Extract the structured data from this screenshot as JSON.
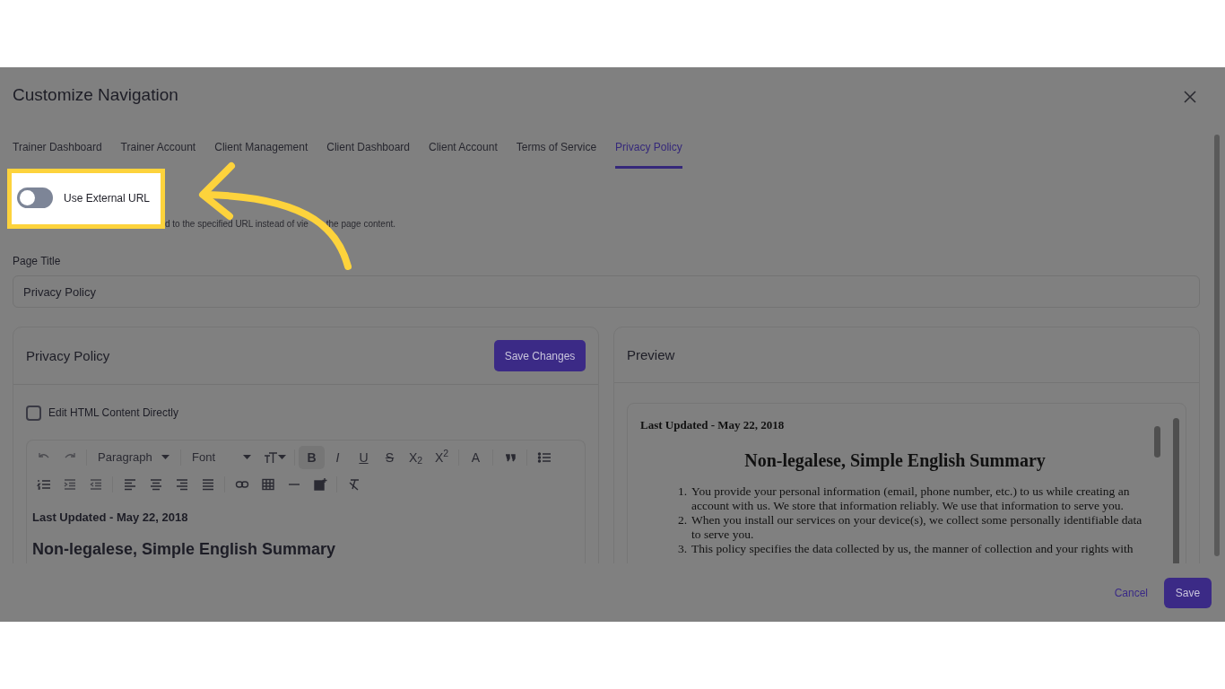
{
  "dialog": {
    "title": "Customize Navigation"
  },
  "tabs": [
    {
      "label": "Trainer Dashboard",
      "selected": false
    },
    {
      "label": "Trainer Account",
      "selected": false
    },
    {
      "label": "Client Management",
      "selected": false
    },
    {
      "label": "Client Dashboard",
      "selected": false
    },
    {
      "label": "Client Account",
      "selected": false
    },
    {
      "label": "Terms of Service",
      "selected": false
    },
    {
      "label": "Privacy Policy",
      "selected": true
    }
  ],
  "external_url": {
    "label": "Use External URL",
    "on": false,
    "hint_fragments": [
      "d to the specified URL instead of vie",
      "the page content."
    ]
  },
  "page_title": {
    "label": "Page Title",
    "value": "Privacy Policy"
  },
  "editor": {
    "title": "Privacy Policy",
    "save_button": "Save Changes",
    "html_mode": {
      "label": "Edit HTML Content Directly",
      "checked": false
    },
    "block_format": "Paragraph",
    "font": "Font",
    "format_buttons": [
      {
        "label": "B",
        "selected": true
      },
      {
        "label": "I",
        "selected": false
      },
      {
        "label": "U",
        "selected": false
      },
      {
        "label": "S",
        "selected": false
      },
      {
        "label": "X$_{2}$",
        "selected": false
      },
      {
        "label": "X$^{2}$",
        "selected": false
      },
      {
        "label": "A",
        "selected": false
      }
    ],
    "content": [
      "Last Updated - May 22, 2018",
      "Non-legalese, Simple English Summary"
    ]
  },
  "preview": {
    "title": "Preview",
    "last_updated": "Last Updated - May 22, 2018",
    "heading": "Non-legalese, Simple English Summary",
    "items": [
      {
        "number": "1.",
        "text": "You provide your personal information (email, phone number, etc.) to us while creating an account with us. We store that information reliably. We use that information to serve you."
      },
      {
        "number": "2.",
        "text": "When you install our services on your device(s), we collect some personally identifiable data to serve you."
      },
      {
        "number": "3.",
        "text": "This policy specifies the data collected by us, the manner of collection and your rights with"
      }
    ]
  },
  "footer": {
    "cancel": "Cancel",
    "save": "Save"
  }
}
